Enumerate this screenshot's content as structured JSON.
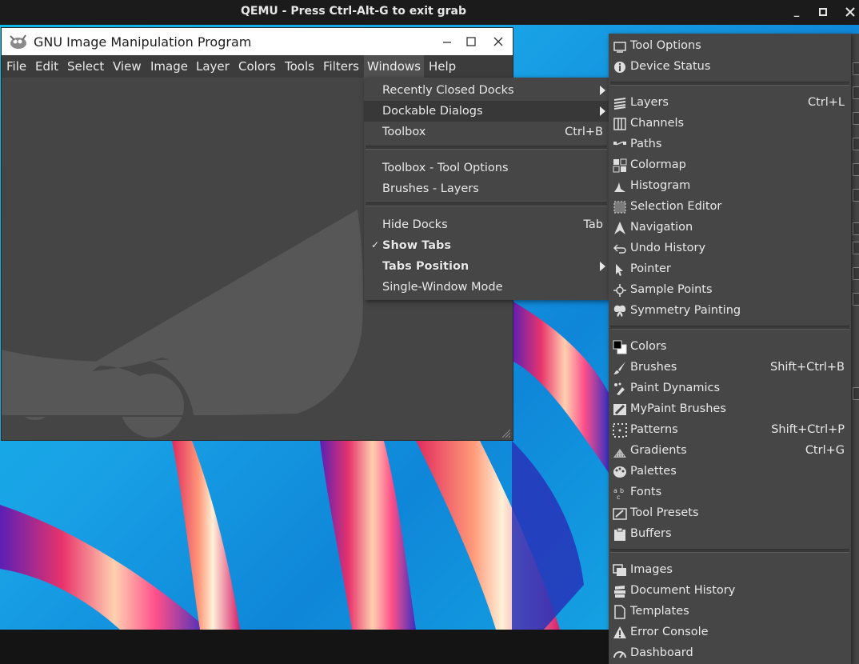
{
  "qemu": {
    "title": "QEMU - Press Ctrl-Alt-G to exit grab",
    "buttons": [
      "minimize",
      "maximize",
      "close"
    ]
  },
  "gimp": {
    "title": "GNU Image Manipulation Program",
    "menubar": [
      "File",
      "Edit",
      "Select",
      "View",
      "Image",
      "Layer",
      "Colors",
      "Tools",
      "Filters",
      "Windows",
      "Help"
    ]
  },
  "windows_menu": {
    "items": [
      {
        "label": "Recently Closed Docks",
        "shortcut": "",
        "submenu": true
      },
      {
        "label": "Dockable Dialogs",
        "shortcut": "",
        "submenu": true,
        "highlighted": true
      },
      {
        "label": "Toolbox",
        "shortcut": "Ctrl+B"
      },
      {
        "label": "Toolbox - Tool Options",
        "shortcut": ""
      },
      {
        "label": "Brushes - Layers",
        "shortcut": ""
      },
      {
        "label": "Hide Docks",
        "shortcut": "Tab"
      },
      {
        "label": "Show Tabs",
        "shortcut": "",
        "checked": true
      },
      {
        "label": "Tabs Position",
        "shortcut": "",
        "submenu": true
      },
      {
        "label": "Single-Window Mode",
        "shortcut": ""
      }
    ]
  },
  "dockable_menu": {
    "items": [
      {
        "label": "Tool Options",
        "shortcut": "",
        "icon": "tool-options-icon"
      },
      {
        "label": "Device Status",
        "shortcut": "",
        "icon": "device-status-icon"
      },
      {
        "label": "Layers",
        "shortcut": "Ctrl+L",
        "icon": "layers-icon"
      },
      {
        "label": "Channels",
        "shortcut": "",
        "icon": "channels-icon"
      },
      {
        "label": "Paths",
        "shortcut": "",
        "icon": "paths-icon"
      },
      {
        "label": "Colormap",
        "shortcut": "",
        "icon": "colormap-icon"
      },
      {
        "label": "Histogram",
        "shortcut": "",
        "icon": "histogram-icon"
      },
      {
        "label": "Selection Editor",
        "shortcut": "",
        "icon": "selection-editor-icon"
      },
      {
        "label": "Navigation",
        "shortcut": "",
        "icon": "navigation-icon"
      },
      {
        "label": "Undo History",
        "shortcut": "",
        "icon": "undo-history-icon"
      },
      {
        "label": "Pointer",
        "shortcut": "",
        "icon": "pointer-icon"
      },
      {
        "label": "Sample Points",
        "shortcut": "",
        "icon": "sample-points-icon"
      },
      {
        "label": "Symmetry Painting",
        "shortcut": "",
        "icon": "symmetry-icon"
      },
      {
        "label": "Colors",
        "shortcut": "",
        "icon": "colors-icon"
      },
      {
        "label": "Brushes",
        "shortcut": "Shift+Ctrl+B",
        "icon": "brushes-icon"
      },
      {
        "label": "Paint Dynamics",
        "shortcut": "",
        "icon": "paint-dynamics-icon"
      },
      {
        "label": "MyPaint Brushes",
        "shortcut": "",
        "icon": "mypaint-brushes-icon"
      },
      {
        "label": "Patterns",
        "shortcut": "Shift+Ctrl+P",
        "icon": "patterns-icon"
      },
      {
        "label": "Gradients",
        "shortcut": "Ctrl+G",
        "icon": "gradients-icon"
      },
      {
        "label": "Palettes",
        "shortcut": "",
        "icon": "palettes-icon"
      },
      {
        "label": "Fonts",
        "shortcut": "",
        "icon": "fonts-icon"
      },
      {
        "label": "Tool Presets",
        "shortcut": "",
        "icon": "tool-presets-icon"
      },
      {
        "label": "Buffers",
        "shortcut": "",
        "icon": "buffers-icon"
      },
      {
        "label": "Images",
        "shortcut": "",
        "icon": "images-icon"
      },
      {
        "label": "Document History",
        "shortcut": "",
        "icon": "document-history-icon"
      },
      {
        "label": "Templates",
        "shortcut": "",
        "icon": "templates-icon"
      },
      {
        "label": "Error Console",
        "shortcut": "",
        "icon": "error-console-icon"
      },
      {
        "label": "Dashboard",
        "shortcut": "",
        "icon": "dashboard-icon"
      }
    ]
  },
  "colors": {
    "menu_bg": "#464646",
    "menu_highlight": "#383838",
    "menu_text": "#e8e8e8",
    "qemu_bar": "#1b1b1b",
    "gimp_bg": "#454545"
  }
}
